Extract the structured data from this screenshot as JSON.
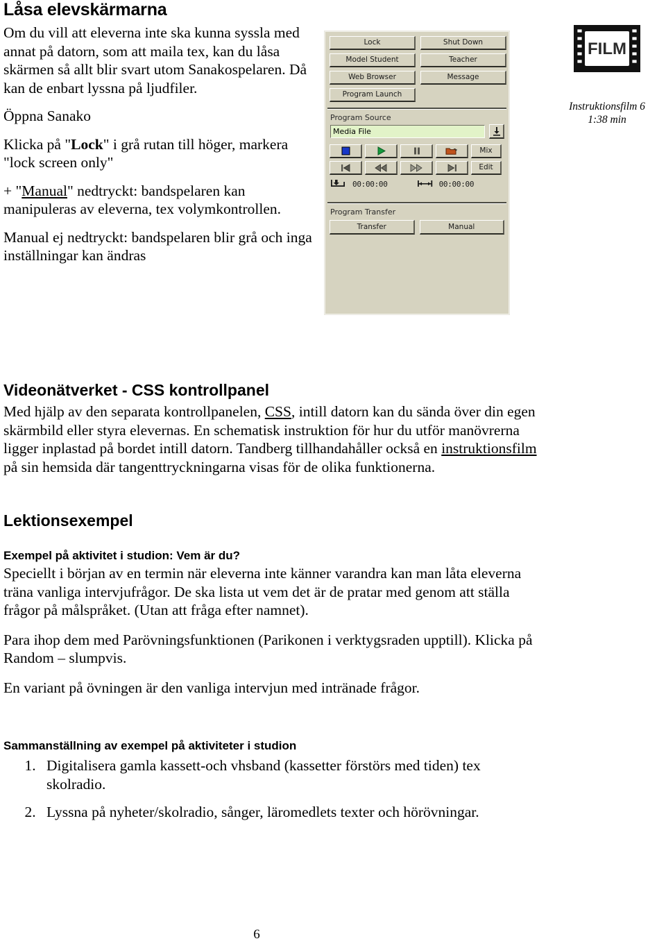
{
  "document": {
    "page_number": "6"
  },
  "left_column": {
    "title": "Låsa elevskärmarna",
    "paragraphs": [
      "Om du vill att eleverna inte ska kunna syssla med annat på datorn, som att maila tex, kan du låsa skärmen så allt blir svart utom Sanakospelaren. Då kan de enbart lyssna på ljudfiler.",
      "Öppna Sanako"
    ],
    "lock_instruction": {
      "prefix": "Klicka på \"",
      "bold": "Lock",
      "suffix": "\" i grå rutan till höger, markera \"lock screen only\""
    },
    "manual_pressed": {
      "prefix": "+ \"",
      "underlined": "Manual",
      "suffix": "\" nedtryckt: bandspelaren kan manipuleras av eleverna, tex volymkontrollen."
    },
    "manual_not_pressed": "Manual ej nedtryckt: bandspelaren blir grå och inga inställningar kan ändras"
  },
  "film_badge": {
    "icon": "film-strip-icon",
    "icon_label": "FILM",
    "caption_line1": "Instruktionsfilm 6",
    "caption_line2": "1:38 min"
  },
  "sanako_panel": {
    "background_color": "#d6d3c0",
    "input_color": "#e2f3c8",
    "command_buttons": [
      "Lock",
      "Shut Down",
      "Model Student",
      "Teacher",
      "Web Browser",
      "Message",
      "Program Launch"
    ],
    "program_source": {
      "label": "Program Source",
      "input_value": "Media File",
      "download_icon": "download-arrow-icon"
    },
    "transport": {
      "row1": [
        {
          "name": "stop-button",
          "icon": "stop-square-icon",
          "label": ""
        },
        {
          "name": "play-button",
          "icon": "play-triangle-icon",
          "label": ""
        },
        {
          "name": "pause-button",
          "icon": "pause-bars-icon",
          "label": ""
        },
        {
          "name": "open-file-button",
          "icon": "open-folder-icon",
          "label": ""
        },
        {
          "name": "mix-button",
          "icon": "",
          "label": "Mix"
        }
      ],
      "row2": [
        {
          "name": "skip-start-button",
          "icon": "skip-to-start-icon",
          "label": ""
        },
        {
          "name": "rewind-button",
          "icon": "rewind-icon",
          "label": ""
        },
        {
          "name": "fast-forward-button",
          "icon": "fast-forward-icon",
          "label": ""
        },
        {
          "name": "skip-end-button",
          "icon": "skip-to-end-icon",
          "label": ""
        },
        {
          "name": "edit-button",
          "icon": "",
          "label": "Edit"
        }
      ],
      "time_start": "00:00:00",
      "time_end": "00:00:00",
      "mark_in_icon": "mark-in-icon",
      "mark_out_icon": "mark-out-icon"
    },
    "program_transfer": {
      "label": "Program Transfer",
      "buttons": [
        "Transfer",
        "Manual"
      ]
    }
  },
  "video_section": {
    "heading": "Videonätverket -  CSS kontrollpanel",
    "body_part1": "Med hjälp av den separata kontrollpanelen, ",
    "body_link1": "CSS",
    "body_part2": ", intill datorn kan du sända över din egen skärmbild eller styra elevernas. En schematisk instruktion för hur du utför manövrerna ligger inplastad på bordet intill datorn. Tandberg tillhandahåller också en ",
    "body_link2": "instruktionsfilm",
    "body_part3": " på sin hemsida där tangenttryckningarna visas för de olika funktionerna."
  },
  "lesson_section": {
    "heading": "Lektionsexempel",
    "subheading": "Exempel på aktivitet i studion: Vem är du?",
    "paragraph1": "Speciellt i början av en termin när eleverna inte känner varandra kan man låta eleverna träna vanliga intervjufrågor. De ska lista ut  vem det är de pratar med genom att ställa frågor på målspråket. (Utan att fråga efter namnet).",
    "paragraph2": "Para ihop dem med Parövningsfunktionen (Parikonen i verktygsraden upptill). Klicka på Random – slumpvis.",
    "paragraph3": "En variant på övningen är den vanliga intervjun med intränade frågor."
  },
  "summary_section": {
    "heading": "Sammanställning av exempel på aktiviteter i studion",
    "items": [
      "Digitalisera gamla kassett-och vhsband (kassetter förstörs med tiden) tex skolradio.",
      "Lyssna på nyheter/skolradio, sånger, läromedlets texter och hörövningar."
    ]
  }
}
